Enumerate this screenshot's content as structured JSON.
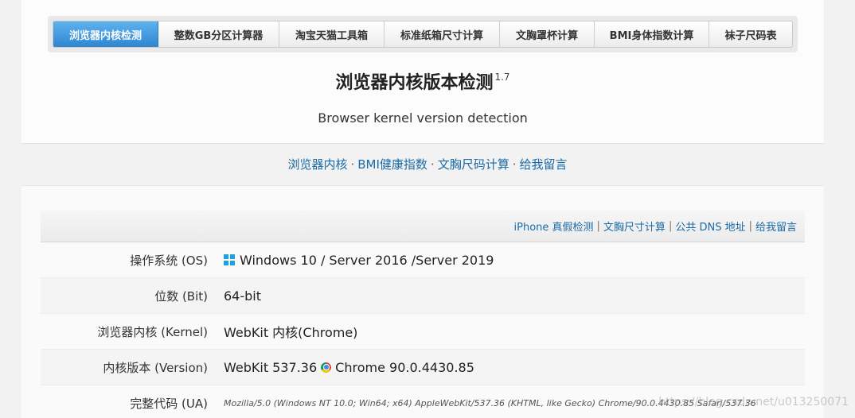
{
  "nav": {
    "tabs": [
      {
        "label": "浏览器内核检测",
        "active": true
      },
      {
        "label": "整数GB分区计算器",
        "active": false
      },
      {
        "label": "淘宝天猫工具箱",
        "active": false
      },
      {
        "label": "标准纸箱尺寸计算",
        "active": false
      },
      {
        "label": "文胸罩杯计算",
        "active": false
      },
      {
        "label": "BMI身体指数计算",
        "active": false
      },
      {
        "label": "袜子尺码表",
        "active": false
      }
    ]
  },
  "header": {
    "title": "浏览器内核版本检测",
    "version": "1.7",
    "subtitle": "Browser kernel version detection"
  },
  "quick_links": {
    "items": [
      "浏览器内核",
      "BMI健康指数",
      "文胸尺码计算",
      "给我留言"
    ],
    "separator": "·"
  },
  "info_links": {
    "items": [
      "iPhone 真假检测",
      "文胸尺寸计算",
      "公共 DNS 地址",
      "给我留言"
    ],
    "separator": "|"
  },
  "detection": {
    "rows": [
      {
        "label": "操作系统 (OS)",
        "value": "Windows 10 / Server 2016 /Server 2019",
        "icon": "windows-icon"
      },
      {
        "label": "位数 (Bit)",
        "value": "64-bit"
      },
      {
        "label": "浏览器内核 (Kernel)",
        "value": "WebKit 内核(Chrome)"
      },
      {
        "label": "内核版本 (Version)",
        "value_prefix": "WebKit 537.36",
        "value_suffix": "Chrome 90.0.4430.85",
        "icon": "chrome-icon"
      },
      {
        "label": "完整代码 (UA)",
        "value": "Mozilla/5.0 (Windows NT 10.0; Win64; x64) AppleWebKit/537.36 (KHTML, like Gecko) Chrome/90.0.4430.85 Safari/537.36"
      }
    ]
  },
  "watermark": "https://blog.csdn.net/u013250071",
  "colors": {
    "active_tab": "#2e86d2",
    "link": "#1a6aa6",
    "windows_icon": "#1ba1e2"
  }
}
